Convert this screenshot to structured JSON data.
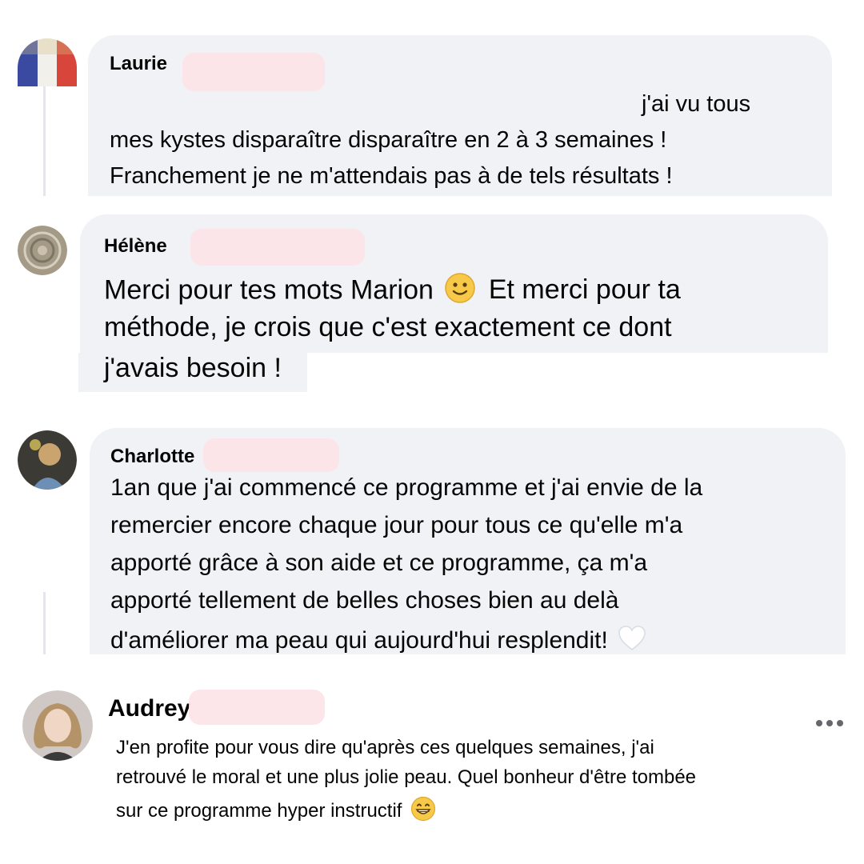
{
  "comments": [
    {
      "name": "Laurie",
      "text": "j'ai vu tous mes kystes disparaître disparaître en 2 à 3 semaines ! Franchement je ne m'attendais pas à de tels résultats !",
      "lines": [
        "j'ai vu tous",
        "mes kystes disparaître disparaître en 2 à 3 semaines !",
        "Franchement je ne m'attendais pas à de tels résultats !"
      ]
    },
    {
      "name": "Hélène",
      "text": "Merci pour tes mots Marion 🙂 Et merci pour ta méthode, je crois que c'est exactement ce dont j'avais besoin !",
      "lines": [
        "Merci pour tes mots Marion",
        "Et merci pour ta",
        "méthode, je crois que c'est exactement ce dont",
        "j'avais besoin !"
      ]
    },
    {
      "name": "Charlotte",
      "text": "1an que j'ai commencé ce programme et j'ai envie de la remercier encore chaque jour pour tous ce qu'elle m'a apporté grâce à son aide et ce programme, ça m'a apporté tellement de belles choses bien au delà d'améliorer ma peau qui aujourd'hui resplendit!",
      "lines": [
        "1an que j'ai commencé ce programme et j'ai envie de la",
        "remercier encore chaque jour pour tous ce qu'elle m'a",
        "apporté grâce à son aide et ce programme, ça m'a",
        "apporté tellement de belles choses bien au delà",
        "d'améliorer ma peau qui aujourd'hui resplendit!"
      ]
    },
    {
      "name": "Audrey",
      "text": "J'en profite pour vous dire qu'après ces quelques semaines, j'ai retrouvé le moral et une plus jolie peau. Quel bonheur d'être tombée sur ce programme hyper instructif",
      "lines": [
        "J'en profite pour vous dire qu'après ces quelques semaines, j'ai",
        "retrouvé le moral et une plus jolie peau. Quel bonheur d'être tombée",
        "sur ce programme hyper instructif"
      ]
    }
  ],
  "icons": {
    "slightly_smiling": "slightly-smiling-face-emoji",
    "white_heart": "white-heart-emoji",
    "grinning": "grinning-face-emoji",
    "more": "more-options-icon"
  },
  "colors": {
    "bubble": "#f0f2f5",
    "text": "#050505",
    "redaction": "#fde3e8",
    "thread_line": "#e4e6eb"
  }
}
